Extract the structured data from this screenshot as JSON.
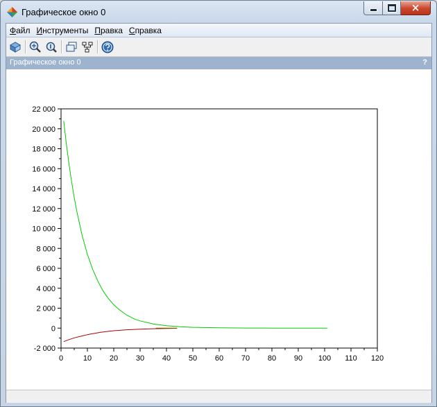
{
  "window": {
    "title": "Графическое окно 0",
    "close_glyph": "×"
  },
  "menu": {
    "file": {
      "accel": "Ф",
      "rest": "айл"
    },
    "tools": {
      "accel": "И",
      "rest": "нструменты"
    },
    "edit": {
      "accel": "П",
      "rest": "равка"
    },
    "help": {
      "accel": "С",
      "rest": "правка"
    }
  },
  "toolbar": {
    "icons": [
      "rotate-icon",
      "zoom-in-icon",
      "zoom-fit-icon",
      "axes-editor-icon",
      "data-tip-icon",
      "help-icon"
    ]
  },
  "panel": {
    "title": "Графическое окно 0",
    "help_mark": "?"
  },
  "chart_data": {
    "type": "line",
    "xlim": [
      0,
      120
    ],
    "ylim": [
      -2000,
      22000
    ],
    "x_ticks": [
      0,
      10,
      20,
      30,
      40,
      50,
      60,
      70,
      80,
      90,
      100,
      110,
      120
    ],
    "y_ticks": [
      -2000,
      0,
      2000,
      4000,
      6000,
      8000,
      10000,
      12000,
      14000,
      16000,
      18000,
      20000,
      22000
    ],
    "x_tick_labels": [
      "0",
      "10",
      "20",
      "30",
      "40",
      "50",
      "60",
      "70",
      "80",
      "90",
      "100",
      "110",
      "120"
    ],
    "y_tick_labels": [
      "-2 000",
      "0",
      "2 000",
      "4 000",
      "6 000",
      "8 000",
      "10 000",
      "12 000",
      "14 000",
      "16 000",
      "18 000",
      "20 000",
      "22 000"
    ],
    "grid": false,
    "series": [
      {
        "color": "#00cc00",
        "x": [
          1,
          2,
          3,
          4,
          5,
          6,
          8,
          10,
          12,
          14,
          16,
          18,
          20,
          22,
          25,
          28,
          30,
          35,
          40,
          45,
          50,
          60,
          70,
          80,
          90,
          101
        ],
        "y": [
          20800,
          18500,
          16500,
          14700,
          13100,
          11700,
          9300,
          7400,
          5900,
          4700,
          3700,
          2950,
          2350,
          1870,
          1300,
          900,
          730,
          420,
          250,
          140,
          80,
          30,
          10,
          5,
          2,
          0
        ]
      },
      {
        "color": "#aa0000",
        "x": [
          1,
          3,
          5,
          8,
          10,
          12,
          15,
          18,
          20,
          25,
          30,
          35,
          40,
          44
        ],
        "y": [
          -1350,
          -1150,
          -980,
          -780,
          -660,
          -550,
          -420,
          -320,
          -260,
          -160,
          -100,
          -60,
          -30,
          -15
        ]
      },
      {
        "color": "#7a5a00",
        "x": [
          36,
          40,
          44
        ],
        "y": [
          0,
          0,
          0
        ]
      }
    ]
  }
}
